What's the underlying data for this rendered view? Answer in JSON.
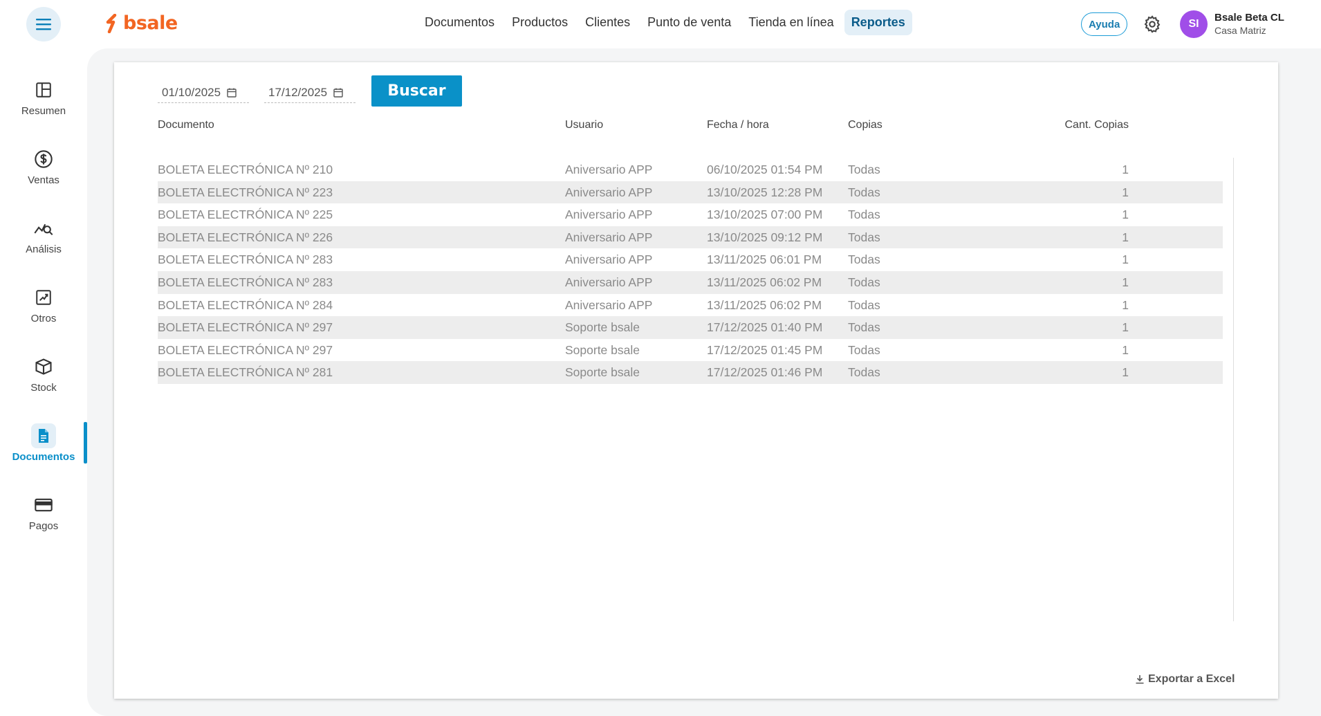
{
  "header": {
    "logo_text": "bsale",
    "brand_color": "#f26522",
    "nav": [
      {
        "label": "Documentos"
      },
      {
        "label": "Productos"
      },
      {
        "label": "Clientes"
      },
      {
        "label": "Punto de venta"
      },
      {
        "label": "Tienda en línea"
      },
      {
        "label": "Reportes",
        "active": true
      }
    ],
    "help_label": "Ayuda",
    "avatar_initials": "SI",
    "user_name": "Bsale Beta CL",
    "user_branch": "Casa Matriz"
  },
  "sidebar": {
    "items": [
      {
        "label": "Resumen",
        "icon": "layout-icon"
      },
      {
        "label": "Ventas",
        "icon": "dollar-icon"
      },
      {
        "label": "Análisis",
        "icon": "analysis-icon"
      },
      {
        "label": "Otros",
        "icon": "chart-icon"
      },
      {
        "label": "Stock",
        "icon": "box-icon"
      },
      {
        "label": "Documentos",
        "icon": "document-icon",
        "active": true
      },
      {
        "label": "Pagos",
        "icon": "card-icon"
      }
    ]
  },
  "filters": {
    "date_from": "01/10/2025",
    "date_to": "17/12/2025",
    "search_label": "Buscar"
  },
  "table": {
    "headers": {
      "documento": "Documento",
      "usuario": "Usuario",
      "fecha": "Fecha / hora",
      "copias": "Copias",
      "cant": "Cant. Copias"
    },
    "rows": [
      {
        "doc": "BOLETA ELECTRÓNICA Nº 210",
        "user": "Aniversario APP",
        "date": "06/10/2025 01:54 PM",
        "copies": "Todas",
        "qty": "1"
      },
      {
        "doc": "BOLETA ELECTRÓNICA Nº 223",
        "user": "Aniversario APP",
        "date": "13/10/2025 12:28 PM",
        "copies": "Todas",
        "qty": "1"
      },
      {
        "doc": "BOLETA ELECTRÓNICA Nº 225",
        "user": "Aniversario APP",
        "date": "13/10/2025 07:00 PM",
        "copies": "Todas",
        "qty": "1"
      },
      {
        "doc": "BOLETA ELECTRÓNICA Nº 226",
        "user": "Aniversario APP",
        "date": "13/10/2025 09:12 PM",
        "copies": "Todas",
        "qty": "1"
      },
      {
        "doc": "BOLETA ELECTRÓNICA Nº 283",
        "user": "Aniversario APP",
        "date": "13/11/2025 06:01 PM",
        "copies": "Todas",
        "qty": "1"
      },
      {
        "doc": "BOLETA ELECTRÓNICA Nº 283",
        "user": "Aniversario APP",
        "date": "13/11/2025 06:02 PM",
        "copies": "Todas",
        "qty": "1"
      },
      {
        "doc": "BOLETA ELECTRÓNICA Nº 284",
        "user": "Aniversario APP",
        "date": "13/11/2025 06:02 PM",
        "copies": "Todas",
        "qty": "1"
      },
      {
        "doc": "BOLETA ELECTRÓNICA Nº 297",
        "user": "Soporte bsale",
        "date": "17/12/2025 01:40 PM",
        "copies": "Todas",
        "qty": "1"
      },
      {
        "doc": "BOLETA ELECTRÓNICA Nº 297",
        "user": "Soporte bsale",
        "date": "17/12/2025 01:45 PM",
        "copies": "Todas",
        "qty": "1"
      },
      {
        "doc": "BOLETA ELECTRÓNICA Nº 281",
        "user": "Soporte bsale",
        "date": "17/12/2025 01:46 PM",
        "copies": "Todas",
        "qty": "1"
      }
    ]
  },
  "export_label": "Exportar a Excel"
}
